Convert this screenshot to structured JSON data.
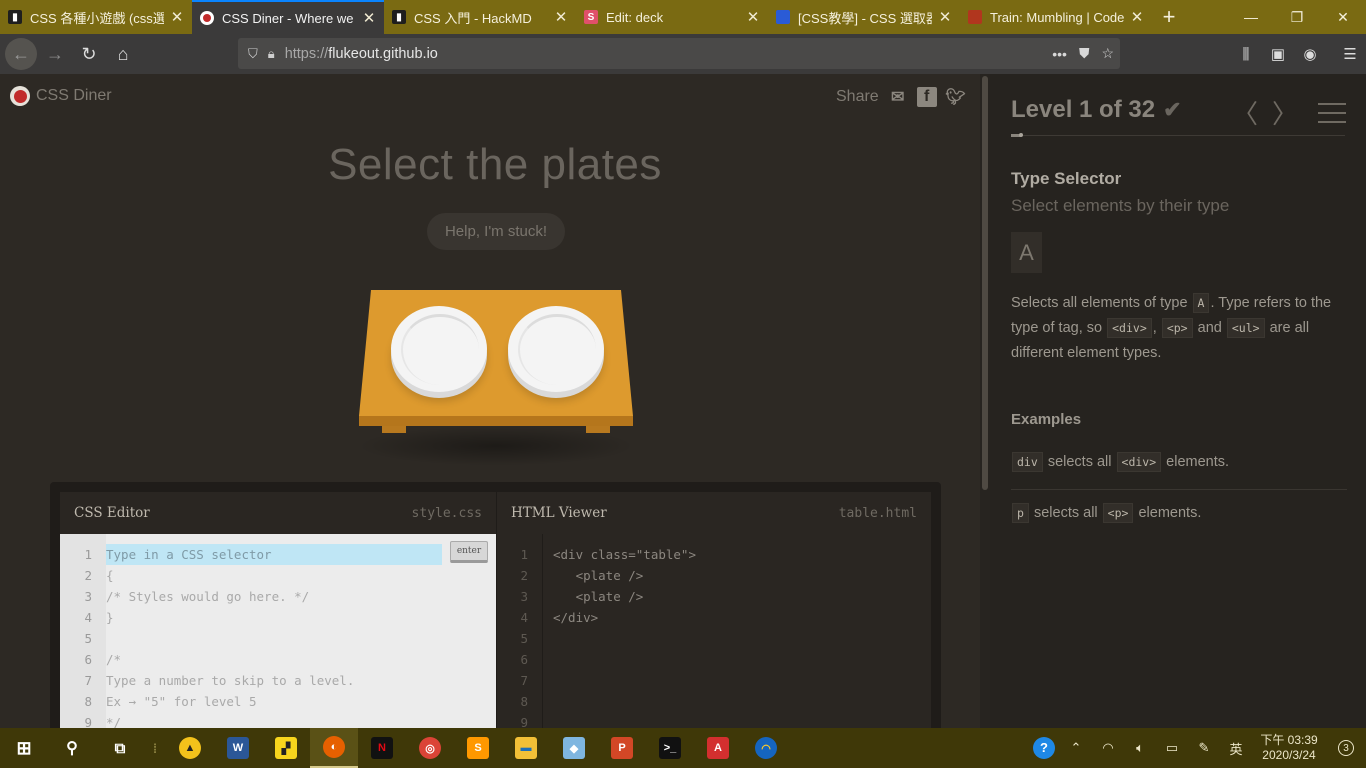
{
  "browser": {
    "tabs": [
      {
        "title": "CSS 各種小遊戲 (css選擇",
        "favicon": "doc-icon",
        "color": "#2a2a2a",
        "active": false
      },
      {
        "title": "CSS Diner - Where we f",
        "favicon": "css-diner-icon",
        "color": "#c12b2b",
        "active": true
      },
      {
        "title": "CSS 入門 - HackMD",
        "favicon": "doc-icon",
        "color": "#2a2a2a",
        "active": false
      },
      {
        "title": "Edit: deck",
        "favicon": "slides-icon",
        "color": "#e0506a",
        "active": false
      },
      {
        "title": "[CSS教學] - CSS 選取器",
        "favicon": "blog-icon",
        "color": "#2a5bd6",
        "active": false
      },
      {
        "title": "Train: Mumbling | Code",
        "favicon": "codewars-icon",
        "color": "#b1361e",
        "active": false
      }
    ],
    "tab_close": "✕",
    "new_tab": "+",
    "url_protocol": "https://",
    "url_host": "flukeout.github.io",
    "url_dots": "•••"
  },
  "page": {
    "logo_text": "CSS Diner",
    "share_label": "Share",
    "title": "Select the plates",
    "help_button": "Help, I'm stuck!",
    "css_editor": {
      "label": "CSS Editor",
      "file": "style.css",
      "enter": "enter",
      "line_numbers": [
        "1",
        "2",
        "3",
        "4",
        "5",
        "6",
        "7",
        "8",
        "9"
      ],
      "lines": [
        "Type in a CSS selector",
        "{",
        "/* Styles would go here. */",
        "}",
        "",
        "/*",
        "Type a number to skip to a level.",
        "Ex → \"5\" for level 5",
        "*/"
      ]
    },
    "html_viewer": {
      "label": "HTML Viewer",
      "file": "table.html",
      "line_numbers": [
        "1",
        "2",
        "3",
        "4",
        "5",
        "6",
        "7",
        "8",
        "9"
      ],
      "lines": [
        "<div class=\"table\">",
        "   <plate />",
        "   <plate />",
        "</div>",
        "",
        "",
        "",
        "",
        ""
      ]
    }
  },
  "sidebar": {
    "level": "Level 1 of 32",
    "progress_fraction": 0.03125,
    "selector_name": "Type Selector",
    "selector_sub": "Select elements by their type",
    "syntax": "A",
    "desc_1": "Selects all elements of type",
    "desc_tag_a": "A",
    "desc_2": ". Type refers to the type of tag, so",
    "desc_tag_div": "<div>",
    "desc_comma": ",",
    "desc_tag_p": "<p>",
    "desc_and": "and",
    "desc_tag_ul": "<ul>",
    "desc_3": "are all different element types.",
    "examples_title": "Examples",
    "ex1_code": "div",
    "ex1_text": "selects all",
    "ex1_tag": "<div>",
    "ex1_end": "elements.",
    "ex2_code": "p",
    "ex2_text": "selects all",
    "ex2_tag": "<p>",
    "ex2_end": "elements."
  },
  "taskbar": {
    "clock_time": "下午 03:39",
    "clock_date": "2020/3/24",
    "ime": "英",
    "notifications": "3"
  }
}
